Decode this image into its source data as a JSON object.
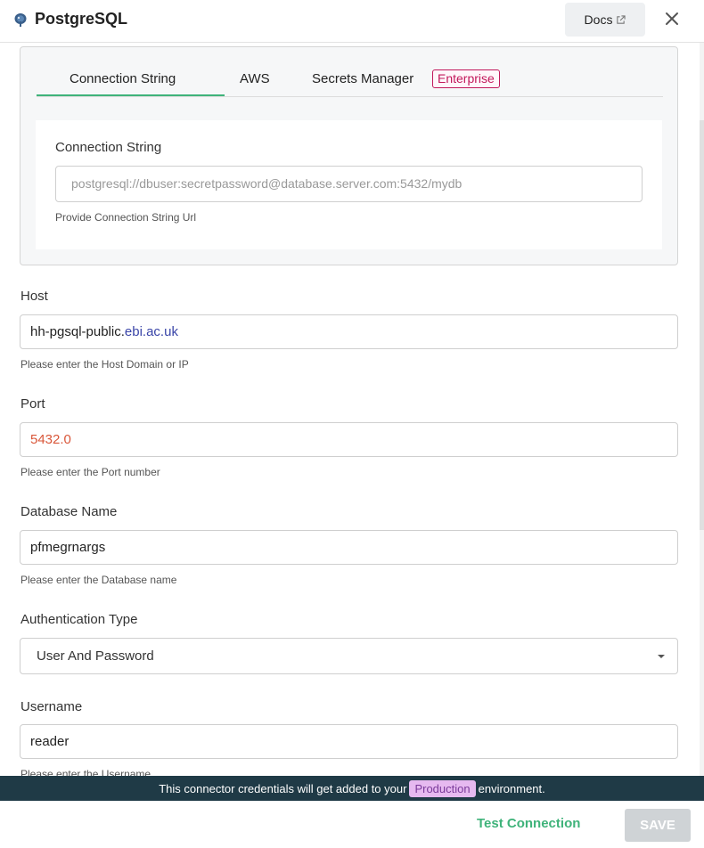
{
  "header": {
    "title": "PostgreSQL",
    "docs_label": "Docs"
  },
  "tabs": [
    {
      "label": "Connection String"
    },
    {
      "label": "AWS"
    },
    {
      "label": "Secrets Manager"
    }
  ],
  "enterprise_badge": "Enterprise",
  "connection_string": {
    "label": "Connection String",
    "placeholder": "postgresql://dbuser:secretpassword@database.server.com:5432/mydb",
    "help": "Provide Connection String Url"
  },
  "host": {
    "label": "Host",
    "value_prefix": "hh-pgsql-public.",
    "value_domain": "ebi.ac.uk",
    "help": "Please enter the Host Domain or IP"
  },
  "port": {
    "label": "Port",
    "value": "5432.0",
    "help": "Please enter the Port number"
  },
  "database": {
    "label": "Database Name",
    "value": "pfmegrnargs",
    "help": "Please enter the Database name"
  },
  "auth": {
    "label": "Authentication Type",
    "value": "User And Password"
  },
  "username": {
    "label": "Username",
    "value": "reader",
    "help": "Please enter the Username"
  },
  "banner": {
    "before": "This connector credentials will get added to your",
    "env": "Production",
    "after": "environment."
  },
  "footer": {
    "test_label": "Test Connection",
    "save_label": "SAVE"
  },
  "colors": {
    "accent_green": "#3fb37a",
    "enterprise": "#c2185b",
    "banner_bg": "#1f3a46"
  }
}
